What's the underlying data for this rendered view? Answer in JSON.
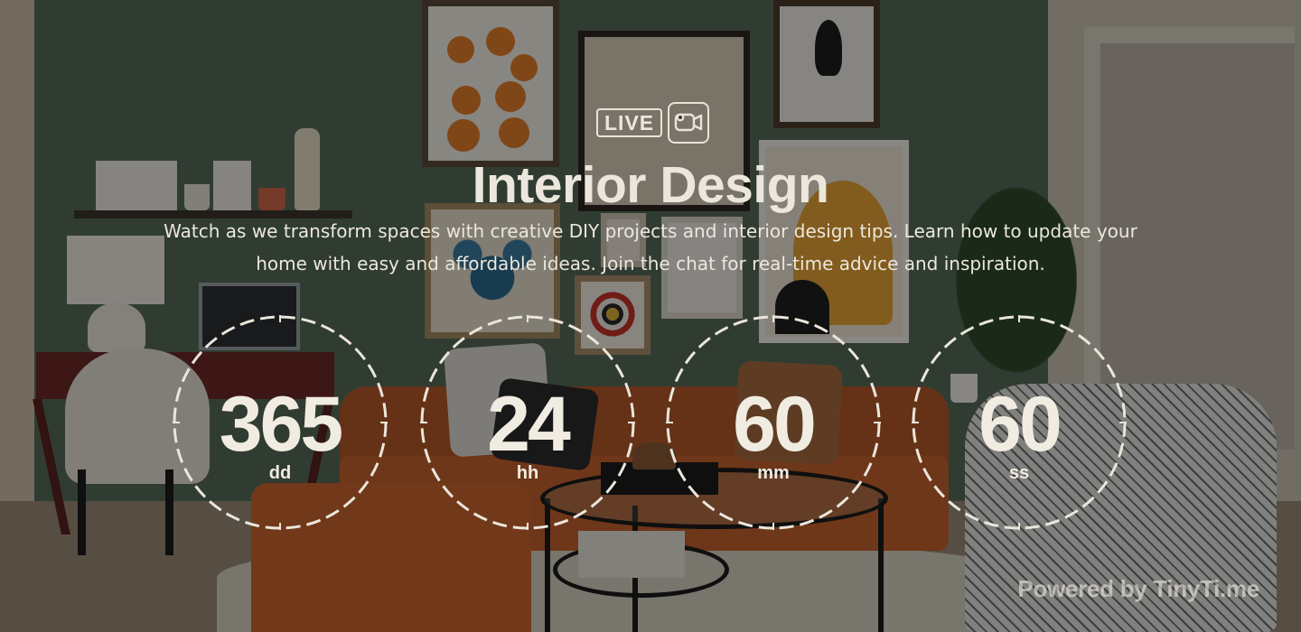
{
  "badge": {
    "label": "LIVE",
    "icon": "video-chat-icon"
  },
  "title": "Interior Design",
  "description": "Watch as we transform spaces with creative DIY projects and interior design tips. Learn how to update your home with easy and affordable ideas. Join the chat for real-time advice and inspiration.",
  "countdown": [
    {
      "value": "365",
      "unit": "dd"
    },
    {
      "value": "24",
      "unit": "hh"
    },
    {
      "value": "60",
      "unit": "mm"
    },
    {
      "value": "60",
      "unit": "ss"
    }
  ],
  "footer": {
    "powered_by": "Powered by TinyTi.me"
  },
  "colors": {
    "text": "#ece7dc",
    "overlay": "rgba(0,0,0,0.44)"
  }
}
